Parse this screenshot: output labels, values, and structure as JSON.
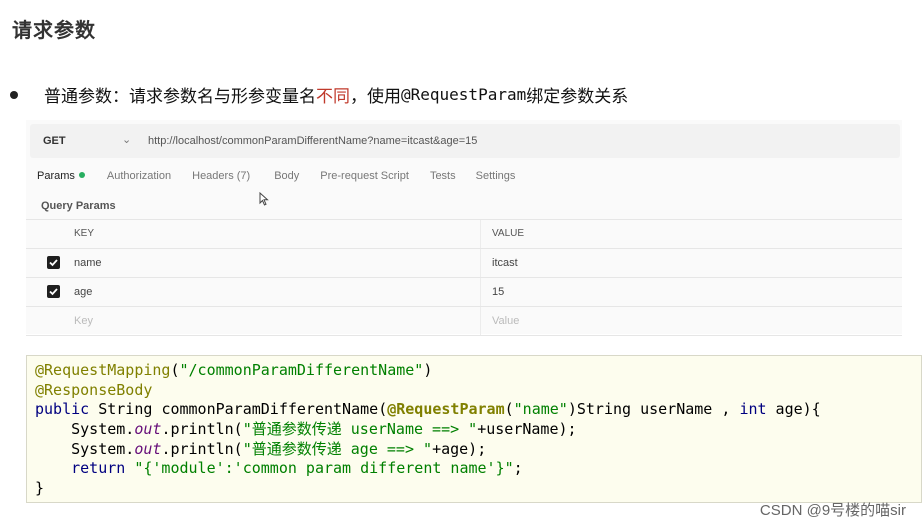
{
  "page": {
    "title": "请求参数",
    "bullet": {
      "part1": "普通参数：请求参数名与形参变量名",
      "highlight": "不同",
      "part2": "，使用",
      "code": "@RequestParam",
      "part3": "绑定参数关系"
    }
  },
  "request": {
    "method": "GET",
    "url": "http://localhost/commonParamDifferentName?name=itcast&age=15"
  },
  "tabs": [
    {
      "label": "Params"
    },
    {
      "label": "Authorization"
    },
    {
      "label": "Headers (7)"
    },
    {
      "label": "Body"
    },
    {
      "label": "Pre-request Script"
    },
    {
      "label": "Tests"
    },
    {
      "label": "Settings"
    }
  ],
  "query_params": {
    "title": "Query Params",
    "header": {
      "key": "KEY",
      "value": "VALUE"
    },
    "rows": [
      {
        "key": "name",
        "value": "itcast",
        "checked": true
      },
      {
        "key": "age",
        "value": "15",
        "checked": true
      }
    ],
    "placeholder": {
      "key": "Key",
      "value": "Value"
    }
  },
  "code": {
    "l1_anno": "@RequestMapping",
    "l1_str": "\"/commonParamDifferentName\"",
    "l2_anno": "@ResponseBody",
    "l3_kw": "public",
    "l3_type": "String",
    "l3_method": "commonParamDifferentName",
    "l3_anno": "@RequestParam",
    "l3_str": "\"name\"",
    "l3_rest1": "String userName , ",
    "l3_kw2": "int",
    "l3_rest2": " age){",
    "l4_a": "    System.",
    "l4_out": "out",
    "l4_b": ".println(",
    "l4_str": "\"普通参数传递 userName ==> \"",
    "l4_c": "+userName);",
    "l5_a": "    System.",
    "l5_out": "out",
    "l5_b": ".println(",
    "l5_str": "\"普通参数传递 age ==> \"",
    "l5_c": "+age);",
    "l6_kw": "    return",
    "l6_str": "\"{'module':'common param different name'}\"",
    "l6_c": ";",
    "l7": "}"
  },
  "watermark": "CSDN @9号楼的喵sir",
  "colors": {
    "active_dot": "#27ae60",
    "highlight": "#c0392b"
  }
}
